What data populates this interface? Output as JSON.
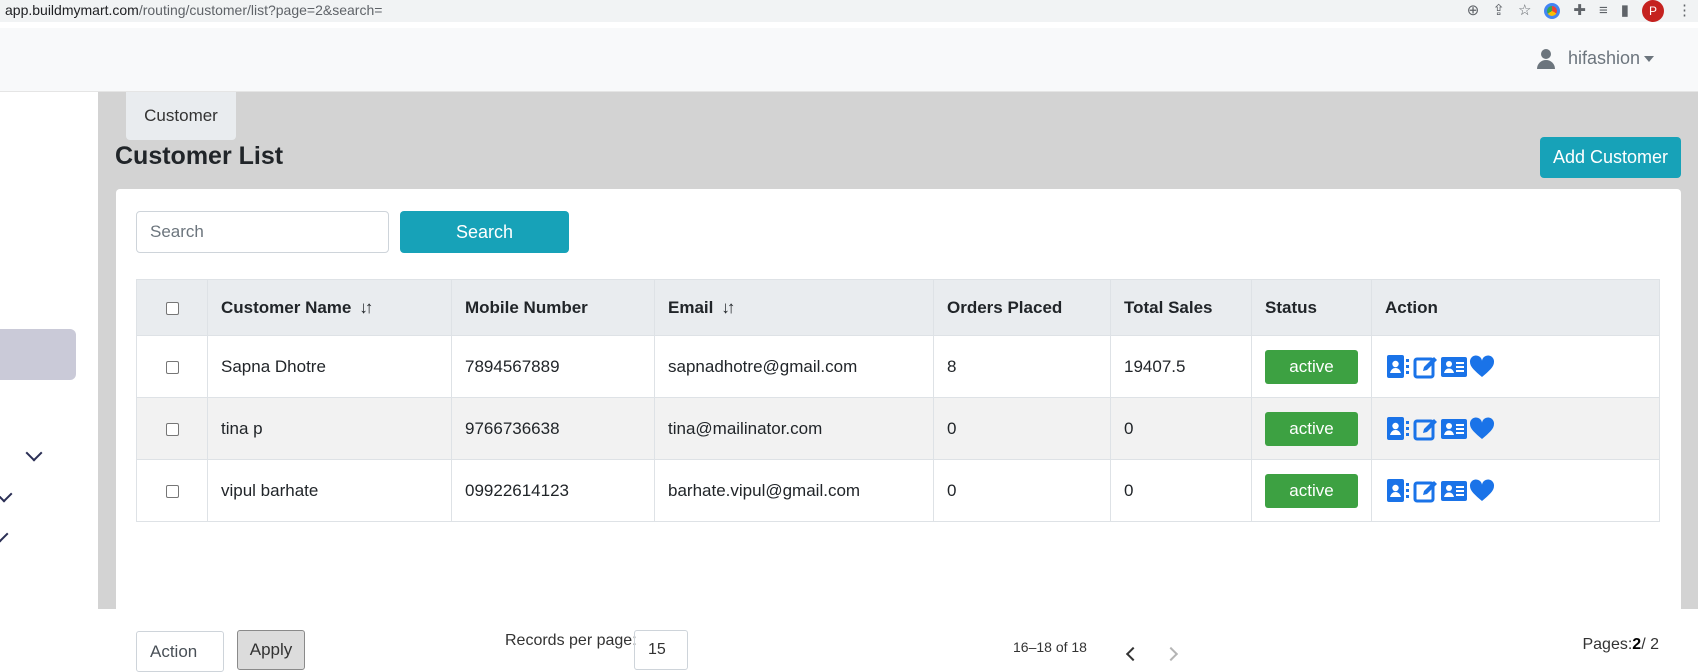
{
  "browser": {
    "url_host": "app.buildmymart.com",
    "url_path": "/routing/customer/list?page=2&search=",
    "profile_initial": "P"
  },
  "header": {
    "username": "hifashion"
  },
  "breadcrumb": "Customer",
  "page": {
    "title": "Customer List",
    "add_button": "Add Customer"
  },
  "search": {
    "placeholder": "Search",
    "button": "Search"
  },
  "table": {
    "columns": [
      "Customer Name",
      "Mobile Number",
      "Email",
      "Orders Placed",
      "Total Sales",
      "Status",
      "Action"
    ],
    "sort_glyph": "↓↑",
    "rows": [
      {
        "name": "Sapna Dhotre",
        "mobile": "7894567889",
        "email": "sapnadhotre@gmail.com",
        "orders": "8",
        "sales": "19407.5",
        "status": "active"
      },
      {
        "name": "tina p",
        "mobile": "9766736638",
        "email": "tina@mailinator.com",
        "orders": "0",
        "sales": "0",
        "status": "active"
      },
      {
        "name": "vipul barhate",
        "mobile": "09922614123",
        "email": "barhate.vipul@gmail.com",
        "orders": "0",
        "sales": "0",
        "status": "active"
      }
    ],
    "action_icons": [
      "contact-card-icon",
      "edit-icon",
      "address-card-icon",
      "heart-icon"
    ],
    "status_color": "#3da142",
    "action_color": "#1a73e8"
  },
  "footer": {
    "action_select": "Action",
    "apply": "Apply",
    "records_label": "Records per page:",
    "records_value": "15",
    "range": "16–18 of 18",
    "pages_label": "Pages:",
    "current_page": "2",
    "total_pages": "/ 2"
  },
  "colors": {
    "accent": "#17a2b8",
    "content_bg": "#d3d3d3"
  }
}
